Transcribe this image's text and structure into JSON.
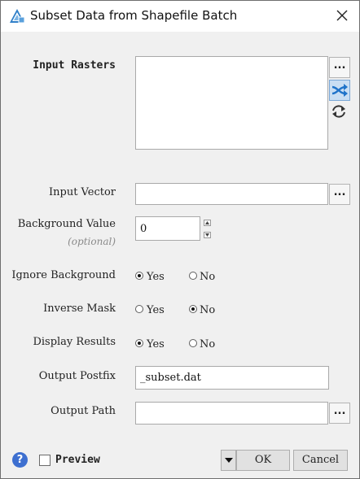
{
  "window": {
    "title": "Subset Data from Shapefile Batch",
    "app_icon": "envi-triangle-icon",
    "close_icon": "close-icon"
  },
  "input_rasters": {
    "label": "Input Rasters",
    "browse_label": "...",
    "shuffle_icon": "shuffle-icon",
    "refresh_icon": "refresh-icon"
  },
  "input_vector": {
    "label": "Input Vector",
    "value": "",
    "browse_label": "..."
  },
  "background_value": {
    "label": "Background Value",
    "optional": "(optional)",
    "value": "0"
  },
  "ignore_background": {
    "label": "Ignore Background",
    "yes": "Yes",
    "no": "No",
    "selected": "Yes"
  },
  "inverse_mask": {
    "label": "Inverse Mask",
    "yes": "Yes",
    "no": "No",
    "selected": "No"
  },
  "display_results": {
    "label": "Display Results",
    "yes": "Yes",
    "no": "No",
    "selected": "Yes"
  },
  "output_postfix": {
    "label": "Output Postfix",
    "value": "_subset.dat"
  },
  "output_path": {
    "label": "Output Path",
    "value": "",
    "browse_label": "..."
  },
  "footer": {
    "help_label": "?",
    "preview_label": "Preview",
    "preview_checked": false,
    "ok_label": "OK",
    "cancel_label": "Cancel"
  },
  "colors": {
    "accent": "#3d6fd0",
    "window_bg": "#f0f0f0",
    "titlebar_bg": "#ffffff"
  }
}
